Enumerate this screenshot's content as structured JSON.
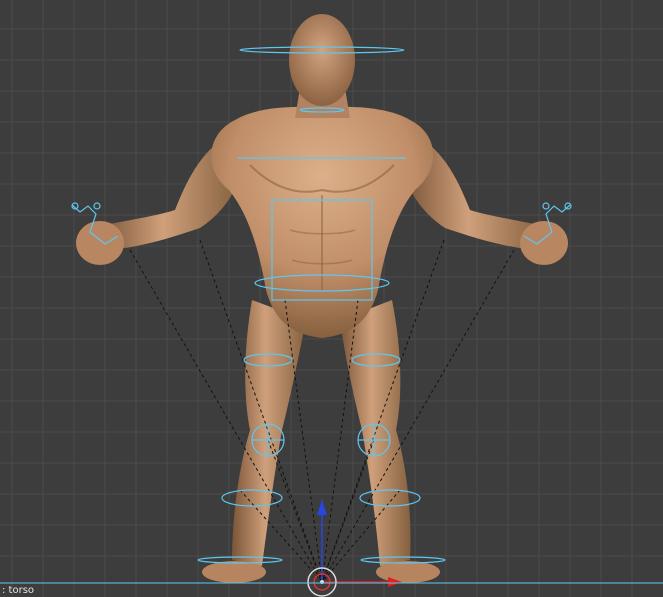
{
  "viewport": {
    "object_label": ": torso",
    "background_color": "#3d3d3d",
    "grid_color": "#4a4a4a",
    "rig_color": "#5fc6f0",
    "skin_color": "#b98863"
  }
}
